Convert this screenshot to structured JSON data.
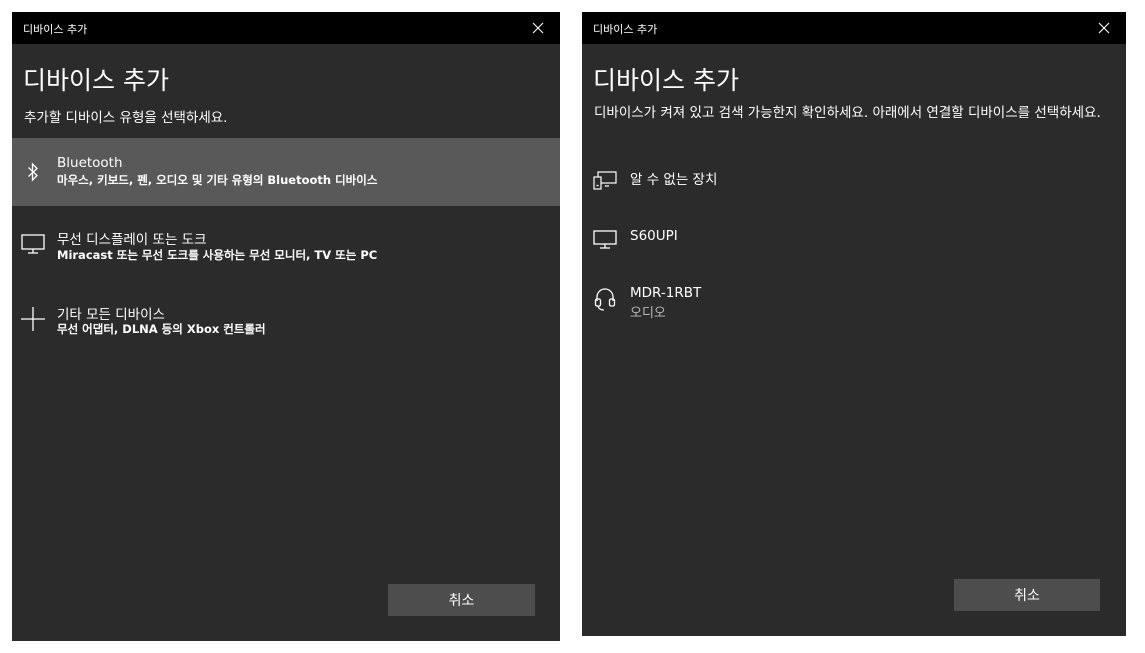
{
  "left_dialog": {
    "window_title": "디바이스 추가",
    "heading": "디바이스 추가",
    "subtitle": "추가할 디바이스 유형을 선택하세요.",
    "options": [
      {
        "title": "Bluetooth",
        "description": "마우스, 키보드, 펜, 오디오 및 기타 유형의 Bluetooth 디바이스",
        "icon": "bluetooth-icon",
        "selected": true
      },
      {
        "title": "무선 디스플레이 또는 도크",
        "description": "Miracast 또는 무선 도크를 사용하는 무선 모니터, TV 또는 PC",
        "icon": "monitor-icon",
        "selected": false
      },
      {
        "title": "기타 모든 디바이스",
        "description": "무선 어댑터, DLNA 등의 Xbox 컨트롤러",
        "icon": "plus-icon",
        "selected": false
      }
    ],
    "cancel_label": "취소"
  },
  "right_dialog": {
    "window_title": "디바이스 추가",
    "heading": "디바이스 추가",
    "instructions": "디바이스가 켜져 있고 검색 가능한지 확인하세요. 아래에서 연결할 디바이스를 선택하세요.",
    "devices": [
      {
        "name": "알 수 없는 장치",
        "type": "",
        "icon": "unknown-device-icon"
      },
      {
        "name": "S60UPI",
        "type": "",
        "icon": "monitor-icon"
      },
      {
        "name": "MDR-1RBT",
        "type": "오디오",
        "icon": "headset-icon"
      }
    ],
    "cancel_label": "취소"
  },
  "colors": {
    "titlebar": "#000000",
    "dialog_background": "#2b2b2b",
    "selected_item": "#595959",
    "button": "#4d4d4d",
    "text": "#ffffff",
    "secondary_text": "#b8b8b8"
  }
}
